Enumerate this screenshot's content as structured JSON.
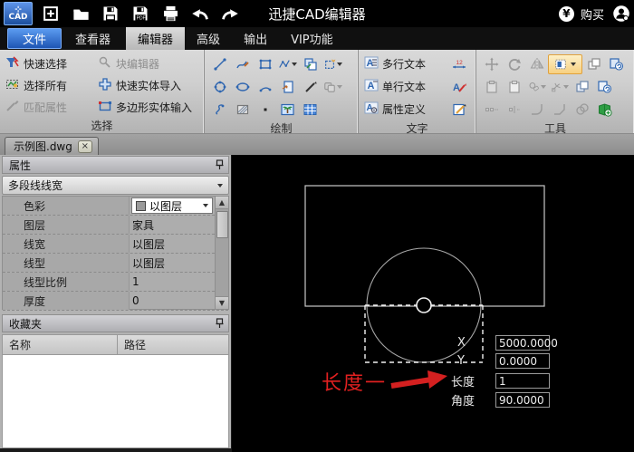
{
  "title_bar": {
    "logo_text": "CAD",
    "app_title": "迅捷CAD编辑器",
    "buy_label": "购买"
  },
  "menu": {
    "items": [
      {
        "label": "文件"
      },
      {
        "label": "查看器"
      },
      {
        "label": "编辑器"
      },
      {
        "label": "高级"
      },
      {
        "label": "输出"
      },
      {
        "label": "VIP功能"
      }
    ]
  },
  "ribbon": {
    "select": {
      "section_label": "选择",
      "items": [
        {
          "label": "快速选择",
          "enabled": true
        },
        {
          "label": "选择所有",
          "enabled": true
        },
        {
          "label": "匹配属性",
          "enabled": false
        },
        {
          "label": "块编辑器",
          "enabled": false
        },
        {
          "label": "快速实体导入",
          "enabled": true
        },
        {
          "label": "多边形实体输入",
          "enabled": true
        }
      ]
    },
    "draw": {
      "section_label": "绘制"
    },
    "text": {
      "section_label": "文字",
      "items": [
        {
          "label": "多行文本"
        },
        {
          "label": "单行文本"
        },
        {
          "label": "属性定义"
        }
      ]
    },
    "tools": {
      "section_label": "工具"
    }
  },
  "tabs": {
    "active_tab": "示例图.dwg"
  },
  "properties_panel": {
    "header": "属性",
    "selector": "多段线线宽",
    "rows": [
      {
        "label": "色彩",
        "value": "以图层"
      },
      {
        "label": "图层",
        "value": "家具"
      },
      {
        "label": "线宽",
        "value": "以图层"
      },
      {
        "label": "线型",
        "value": "以图层"
      },
      {
        "label": "线型比例",
        "value": "1"
      },
      {
        "label": "厚度",
        "value": "0"
      }
    ]
  },
  "favorites_panel": {
    "header": "收藏夹",
    "columns": [
      {
        "label": "名称"
      },
      {
        "label": "路径"
      }
    ]
  },
  "canvas": {
    "inputs": [
      {
        "label": "X",
        "value": "5000.0000"
      },
      {
        "label": "Y",
        "value": "0.0000"
      },
      {
        "label": "长度",
        "value": "1"
      },
      {
        "label": "角度",
        "value": "90.0000"
      }
    ],
    "annotation": "长度一"
  },
  "icons": {
    "yen_symbol": "¥",
    "close_glyph": "×",
    "arrow_up": "▲",
    "arrow_down": "▼"
  },
  "colors": {
    "accent_blue": "#2f66b0",
    "menu_active_blue": "#2a64c8",
    "highlight_orange": "#e0a13c",
    "annotation_red": "#e02020",
    "canvas_bg": "#000000",
    "ribbon_gray": "#c9c9c9"
  }
}
